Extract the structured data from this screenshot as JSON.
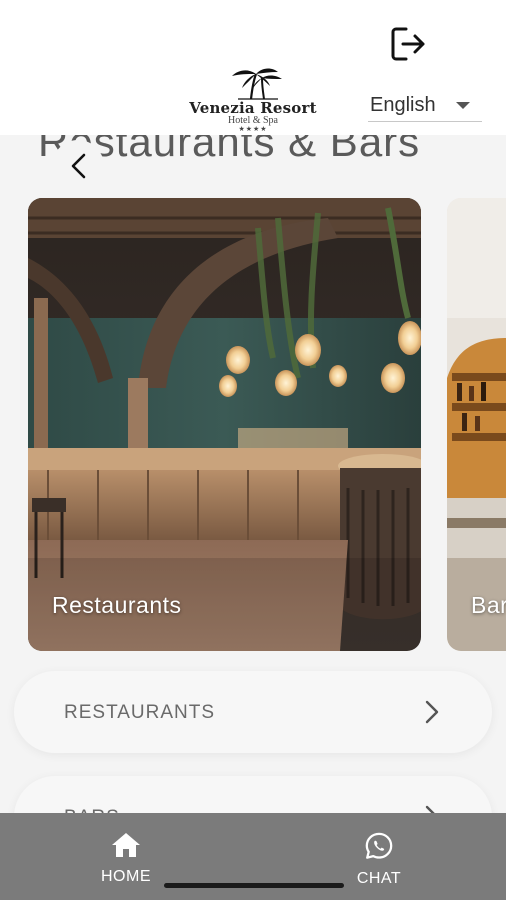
{
  "header": {
    "brand_name": "Venezia Resort",
    "brand_sub": "Hotel & Spa",
    "brand_stars": "★★★★",
    "language": "English"
  },
  "page": {
    "title": "Restaurants & Bars"
  },
  "cards": [
    {
      "label": "Restaurants"
    },
    {
      "label": "Bars"
    }
  ],
  "list": [
    {
      "label": "RESTAURANTS"
    },
    {
      "label": "BARS"
    }
  ],
  "bottom_nav": {
    "home_label": "HOME",
    "chat_label": "CHAT"
  },
  "icons": {
    "logout": "logout-icon",
    "back": "chevron-left-icon",
    "home": "home-icon",
    "chat": "whatsapp-chat-icon",
    "chevron": "chevron-right-icon"
  }
}
